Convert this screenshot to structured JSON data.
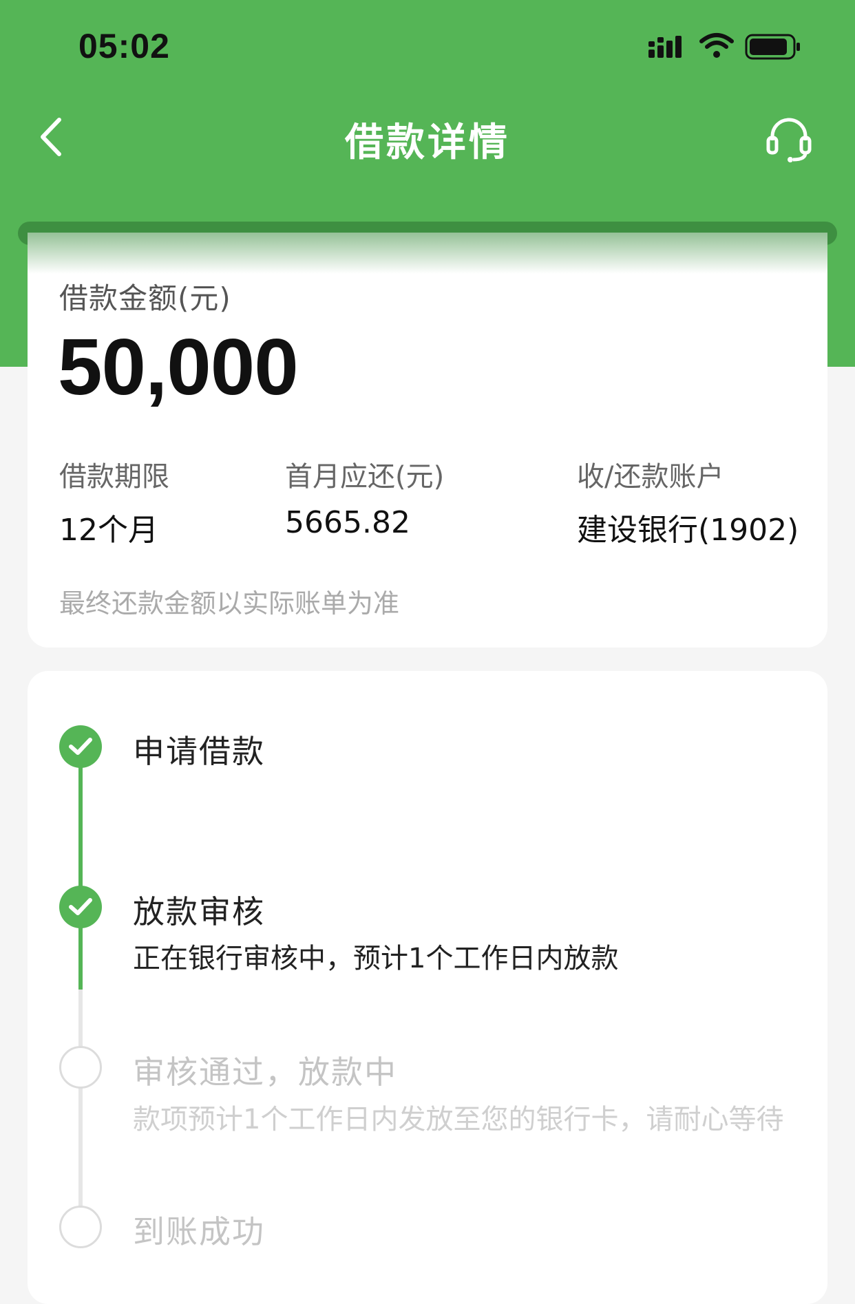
{
  "status_bar": {
    "time": "05:02"
  },
  "nav": {
    "title": "借款详情"
  },
  "loan": {
    "amount_label": "借款金额(元)",
    "amount_value": "50,000",
    "info": [
      {
        "label": "借款期限",
        "value": "12个月"
      },
      {
        "label": "首月应还(元)",
        "value": "5665.82"
      },
      {
        "label": "收/还款账户",
        "value": "建设银行(1902)"
      }
    ],
    "disclaimer": "最终还款金额以实际账单为准"
  },
  "steps": [
    {
      "title": "申请借款",
      "desc": "",
      "status": "done"
    },
    {
      "title": "放款审核",
      "desc": "正在银行审核中，预计1个工作日内放款",
      "status": "done"
    },
    {
      "title": "审核通过，放款中",
      "desc": "款项预计1个工作日内发放至您的银行卡，请耐心等待",
      "status": "pending"
    },
    {
      "title": "到账成功",
      "desc": "",
      "status": "pending"
    }
  ],
  "colors": {
    "brand_green": "#55b556",
    "pending_gray": "#c4c4c4"
  },
  "icons": [
    "back-arrow-icon",
    "headset-icon",
    "signal-icon",
    "wifi-icon",
    "battery-icon",
    "check-icon"
  ]
}
